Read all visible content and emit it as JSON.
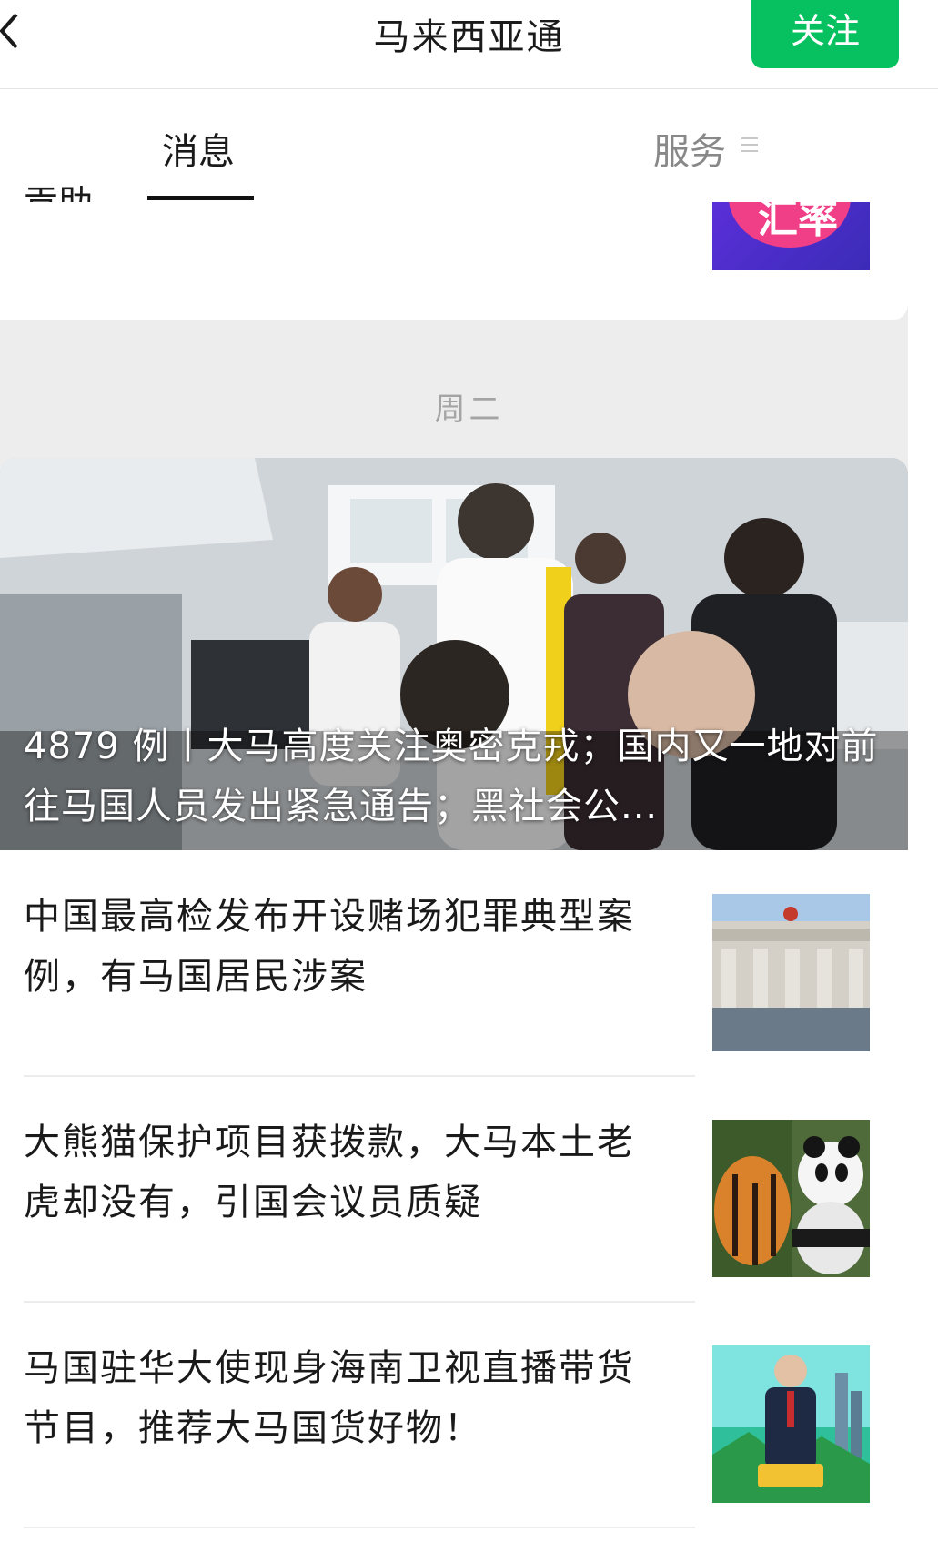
{
  "header": {
    "account_name": "马来西亚通",
    "follow_label": "关注",
    "back_icon": "chevron-left-icon"
  },
  "tabs": [
    {
      "label": "消息",
      "active": true
    },
    {
      "label": "服务",
      "active": false,
      "icon": "menu-icon"
    }
  ],
  "top_card": {
    "cut_title": "贡助",
    "thumb_word": "汇率"
  },
  "day_group": "周二",
  "hero_article": {
    "title": "4879 例丨大马高度关注奥密克戎；国内又一地对前往马国人员发出紧急通告；黑社会公..."
  },
  "articles": [
    {
      "title": "中国最高检发布开设赌场犯罪典型案例，有马国居民涉案"
    },
    {
      "title": "大熊猫保护项目获拨款，大马本土老虎却没有，引国会议员质疑"
    },
    {
      "title": "马国驻华大使现身海南卫视直播带货节目，推荐大马国货好物！"
    }
  ],
  "colors": {
    "accent": "#07c160",
    "background": "#ededed"
  }
}
